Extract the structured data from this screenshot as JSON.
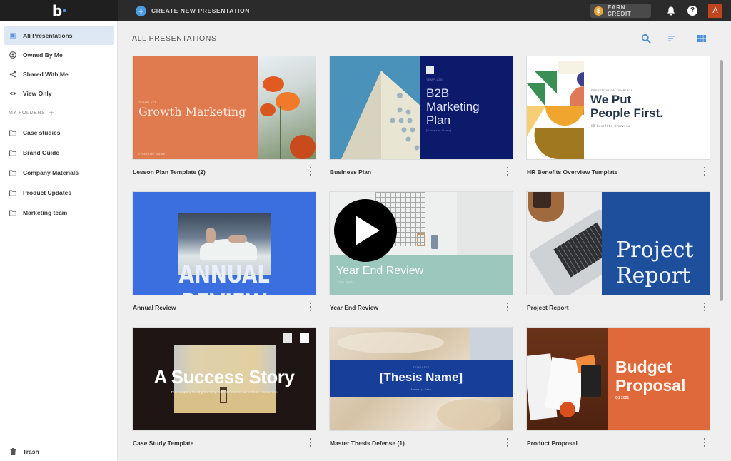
{
  "topbar": {
    "logo": "b",
    "create_label": "CREATE NEW PRESENTATION",
    "earn_credit_label": "EARN CREDIT",
    "coin_symbol": "$",
    "help_symbol": "?",
    "avatar_initial": "A"
  },
  "sidebar": {
    "items": [
      {
        "label": "All Presentations",
        "icon": "grid-icon",
        "active": true
      },
      {
        "label": "Owned By Me",
        "icon": "user-icon"
      },
      {
        "label": "Shared With Me",
        "icon": "share-icon"
      },
      {
        "label": "View Only",
        "icon": "eye-icon"
      }
    ],
    "folders_label": "MY FOLDERS",
    "folders_add": "+",
    "folders": [
      {
        "label": "Case studies"
      },
      {
        "label": "Brand Guide"
      },
      {
        "label": "Company Materials"
      },
      {
        "label": "Product Updates"
      },
      {
        "label": "Marketing team"
      }
    ],
    "trash_label": "Trash"
  },
  "main": {
    "title": "ALL PRESENTATIONS",
    "toolbar": {
      "search": "search-icon",
      "sort": "sort-icon",
      "view": "grid-view-icon"
    },
    "cards": [
      {
        "name": "Lesson Plan Template (2)",
        "slide": {
          "eyebrow": "TEMPLATE",
          "title": "Growth Marketing",
          "footer": "Presenter Name",
          "bg": "#e07a4f"
        }
      },
      {
        "name": "Business Plan",
        "slide": {
          "eyebrow": "TEMPLATE",
          "title_lines": [
            "B2B",
            "Marketing",
            "Plan"
          ],
          "sub": "[Company Name]",
          "bg": "#0c1a6b"
        }
      },
      {
        "name": "HR Benefits Overview Template",
        "slide": {
          "eyebrow": "PRESENTATION TEMPLATE",
          "title_lines": [
            "We Put",
            "People First."
          ],
          "sub": "HR Benefits Overview"
        }
      },
      {
        "name": "Annual Review",
        "slide": {
          "title": "ANNUAL REVIEW",
          "bg": "#3b6fe0"
        }
      },
      {
        "name": "Year End Review",
        "slide": {
          "title": "Year End Review",
          "sub": "2019-2020",
          "band": "#9cc7bd"
        },
        "has_video": true
      },
      {
        "name": "Project Report",
        "slide": {
          "title_lines": [
            "Project",
            "Report"
          ],
          "bg": "#1d4f9c"
        }
      },
      {
        "name": "Case Study Template",
        "slide": {
          "title": "A Success Story",
          "sub": "This company faced great things with the help of our product. Here's how."
        }
      },
      {
        "name": "Master Thesis Defense (1)",
        "slide": {
          "eyebrow": "TEMPLATE",
          "title": "[Thesis Name]",
          "sub": "Name  |  Date",
          "band": "#173f99"
        }
      },
      {
        "name": "Product Proposal",
        "slide": {
          "title_lines": [
            "Budget",
            "Proposal"
          ],
          "sub": "Q1 2021",
          "bg": "#e0693c"
        }
      }
    ]
  }
}
